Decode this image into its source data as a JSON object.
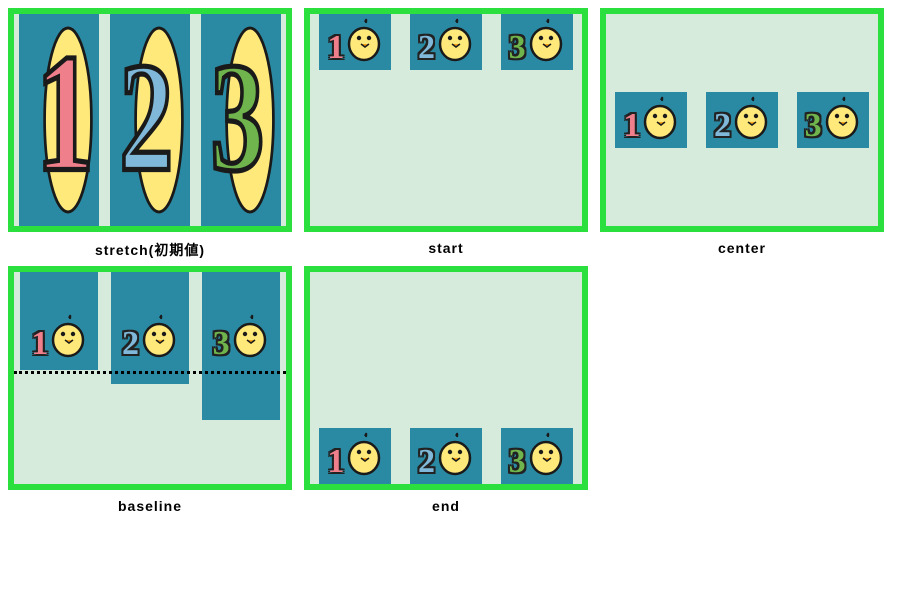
{
  "panels": [
    {
      "key": "stretch",
      "label": "stretch(初期値)",
      "items": [
        1,
        2,
        3
      ]
    },
    {
      "key": "start",
      "label": "start",
      "items": [
        1,
        2,
        3
      ]
    },
    {
      "key": "center",
      "label": "center",
      "items": [
        1,
        2,
        3
      ]
    },
    {
      "key": "baseline",
      "label": "baseline",
      "items": [
        1,
        2,
        3
      ],
      "dotted_baseline": true
    },
    {
      "key": "end",
      "label": "end",
      "items": [
        1,
        2,
        3
      ]
    }
  ],
  "colors": {
    "border": "#2be03e",
    "panel_bg": "#d7ebdc",
    "item_bg": "#2a8aa3",
    "num1": "#ef7f8a",
    "num2": "#7fb8d8",
    "num3": "#6fb44c",
    "chick_body": "#ffe97a",
    "chick_outline": "#1a1a1a",
    "chick_beak": "#f4a21a"
  },
  "numbers": {
    "1": "1",
    "2": "2",
    "3": "3"
  }
}
